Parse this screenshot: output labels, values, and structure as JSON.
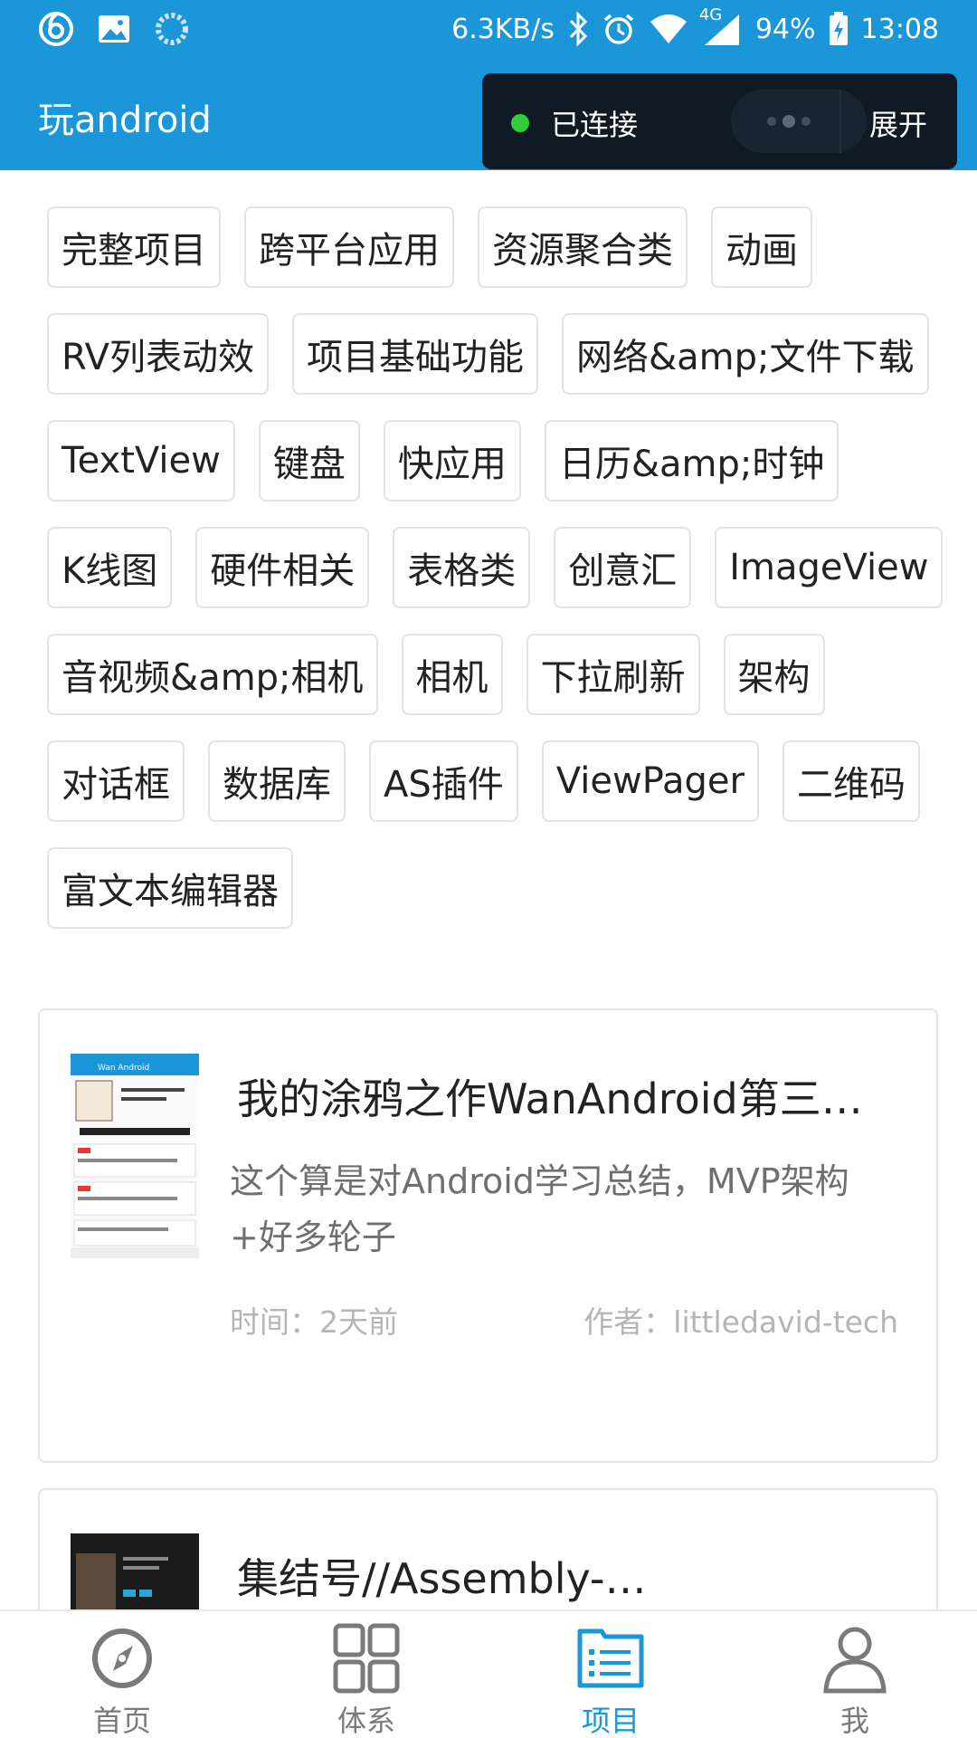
{
  "status_bar": {
    "speed": "6.3KB/s",
    "network": "4G",
    "battery": "94%",
    "time": "13:08",
    "icons": [
      "netease-music-icon",
      "gallery-icon",
      "loading-icon",
      "bluetooth-icon",
      "alarm-icon",
      "wifi-icon",
      "signal-icon",
      "battery-charging-icon"
    ]
  },
  "app_bar": {
    "title": "玩android"
  },
  "overlay": {
    "status": "已连接",
    "expand": "展开"
  },
  "tags": [
    "完整项目",
    "跨平台应用",
    "资源聚合类",
    "动画",
    "RV列表动效",
    "项目基础功能",
    "网络&amp;文件下载",
    "TextView",
    "键盘",
    "快应用",
    "日历&amp;时钟",
    "K线图",
    "硬件相关",
    "表格类",
    "创意汇",
    "ImageView",
    "音视频&amp;相机",
    "相机",
    "下拉刷新",
    "架构",
    "对话框",
    "数据库",
    "AS插件",
    "ViewPager",
    "二维码",
    "富文本编辑器"
  ],
  "projects": [
    {
      "title": "我的涂鸦之作WanAndroid第三…",
      "desc": "这个算是对Android学习总结，MVP架构+好多轮子",
      "time": "时间：2天前",
      "author": "作者：littledavid-tech",
      "thumb_header": "Wan Android"
    },
    {
      "title": "集结号//Assembly-…"
    }
  ],
  "bottom_nav": [
    {
      "label": "首页",
      "icon": "compass-icon"
    },
    {
      "label": "体系",
      "icon": "grid-icon"
    },
    {
      "label": "项目",
      "icon": "list-icon"
    },
    {
      "label": "我",
      "icon": "person-icon"
    }
  ],
  "colors": {
    "primary": "#1a96d9",
    "overlay": "#0f1a24",
    "connected": "#2fcf3a"
  }
}
